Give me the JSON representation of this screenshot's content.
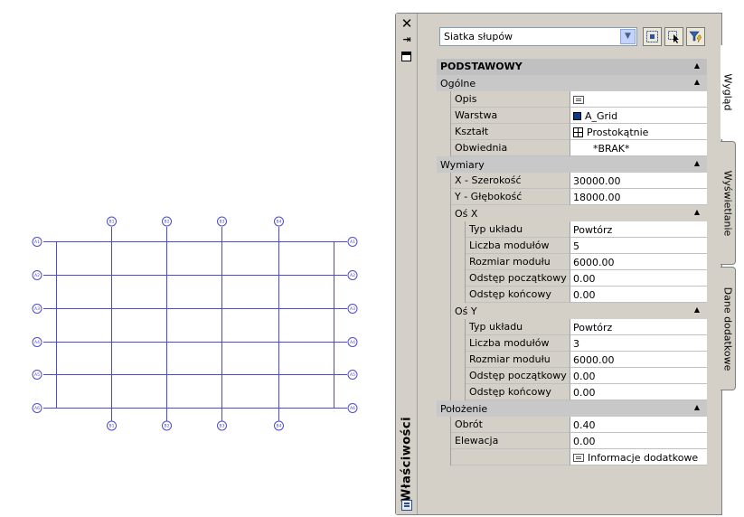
{
  "drawing": {
    "rows": [
      "A1",
      "A2",
      "A3",
      "A4",
      "A5",
      "A6"
    ],
    "cols": [
      "B1",
      "B2",
      "B3",
      "B4"
    ],
    "line_color": "#4b4bd6"
  },
  "palette": {
    "title": "Właściwości",
    "object_type": "Siatka słupów",
    "tabs": {
      "view": "Wygląd",
      "display": "Wyświetlanie",
      "extra": "Dane dodatkowe"
    },
    "sections": {
      "basic": "PODSTAWOWY",
      "general": "Ogólne",
      "dimensions": "Wymiary",
      "axis_x": "Oś X",
      "axis_y": "Oś Y",
      "location": "Położenie"
    },
    "general": {
      "description_label": "Opis",
      "layer_label": "Warstwa",
      "layer_value": "A_Grid",
      "shape_label": "Kształt",
      "shape_value": "Prostokątnie",
      "boundary_label": "Obwiednia",
      "boundary_value": "*BRAK*"
    },
    "dimensions": {
      "x_width_label": "X - Szerokość",
      "x_width_value": "30000.00",
      "y_depth_label": "Y - Głębokość",
      "y_depth_value": "18000.00"
    },
    "axis_x": {
      "layout_type_label": "Typ układu",
      "layout_type_value": "Powtórz",
      "count_label": "Liczba modułów",
      "count_value": "5",
      "module_size_label": "Rozmiar modułu",
      "module_size_value": "6000.00",
      "start_offset_label": "Odstęp początkowy",
      "start_offset_value": "0.00",
      "end_offset_label": "Odstęp końcowy",
      "end_offset_value": "0.00"
    },
    "axis_y": {
      "layout_type_label": "Typ układu",
      "layout_type_value": "Powtórz",
      "count_label": "Liczba modułów",
      "count_value": "3",
      "module_size_label": "Rozmiar modułu",
      "module_size_value": "6000.00",
      "start_offset_label": "Odstęp początkowy",
      "start_offset_value": "0.00",
      "end_offset_label": "Odstęp końcowy",
      "end_offset_value": "0.00"
    },
    "location": {
      "rotation_label": "Obrót",
      "rotation_value": "0.40",
      "elevation_label": "Elewacja",
      "elevation_value": "0.00",
      "additional_info": "Informacje dodatkowe"
    }
  }
}
